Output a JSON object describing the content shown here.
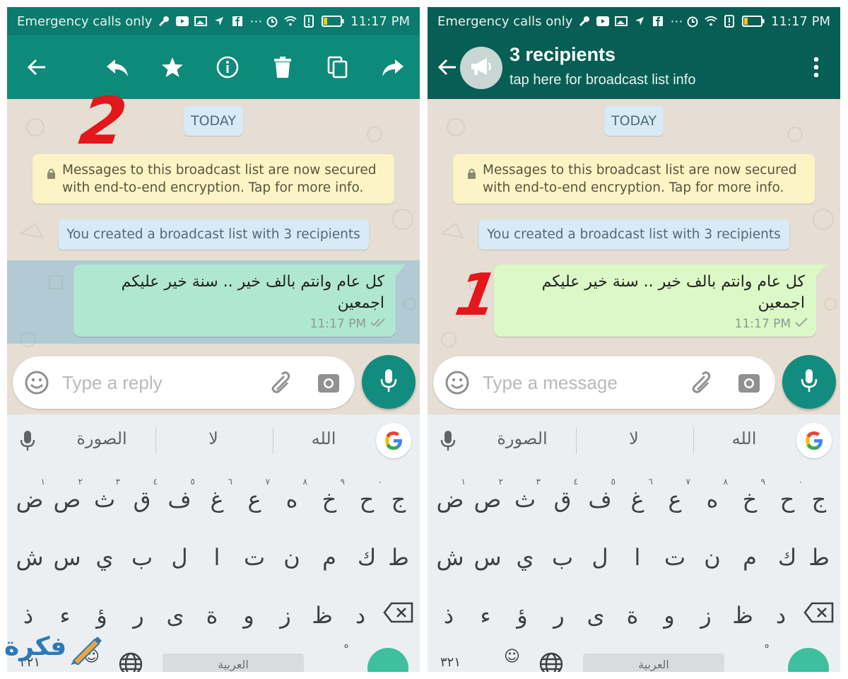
{
  "status_bar": {
    "carrier": "Emergency calls only",
    "time": "11:17 PM"
  },
  "selection_toolbar": {
    "icons": [
      "back-arrow-icon",
      "reply-icon",
      "star-icon",
      "info-icon",
      "delete-icon",
      "copy-icon",
      "forward-icon"
    ]
  },
  "chat_header": {
    "title": "3 recipients",
    "subtitle": "tap here for broadcast list info"
  },
  "chat": {
    "date_divider": "TODAY",
    "encryption_notice": "Messages to this broadcast list are now secured with end-to-end encryption. Tap for more info.",
    "created_notice": "You created a broadcast list with 3 recipients",
    "message": {
      "text": "كل عام وانتم بالف خير .. سنة خير عليكم اجمعين",
      "time": "11:17 PM"
    }
  },
  "composer": {
    "reply_placeholder": "Type a reply",
    "message_placeholder": "Type a message"
  },
  "keyboard": {
    "suggestions": [
      "الصورة",
      "لا",
      "الله"
    ],
    "row1": [
      {
        "char": "ض",
        "hint": "١"
      },
      {
        "char": "ص",
        "hint": "٢"
      },
      {
        "char": "ث",
        "hint": "٣"
      },
      {
        "char": "ق",
        "hint": "٤"
      },
      {
        "char": "ف",
        "hint": "٥"
      },
      {
        "char": "غ",
        "hint": "٦"
      },
      {
        "char": "ع",
        "hint": "٧"
      },
      {
        "char": "ه",
        "hint": "٨"
      },
      {
        "char": "خ",
        "hint": "٩"
      },
      {
        "char": "ح",
        "hint": "٠"
      },
      {
        "char": "ج",
        "hint": ""
      }
    ],
    "row2": [
      "ش",
      "س",
      "ي",
      "ب",
      "ل",
      "ا",
      "ت",
      "ن",
      "م",
      "ك",
      "ط"
    ],
    "row3": [
      "ذ",
      "ء",
      "ؤ",
      "ر",
      "ى",
      "ة",
      "و",
      "ز",
      "ظ",
      "د"
    ],
    "numbers_key": "٣٢١",
    "space_label": "العربية",
    "period_key": "°"
  },
  "annotations": {
    "left": "2",
    "right": "1"
  },
  "watermark": {
    "text": "فكرة"
  },
  "colors": {
    "toolbar_teal": "#0d8a7a",
    "header_dark_teal": "#075e54",
    "outgoing_bubble": "#dcf8c6",
    "selected_bubble": "#b0e7d1",
    "fab": "#128c7e",
    "annotation_red": "#e3171c"
  }
}
